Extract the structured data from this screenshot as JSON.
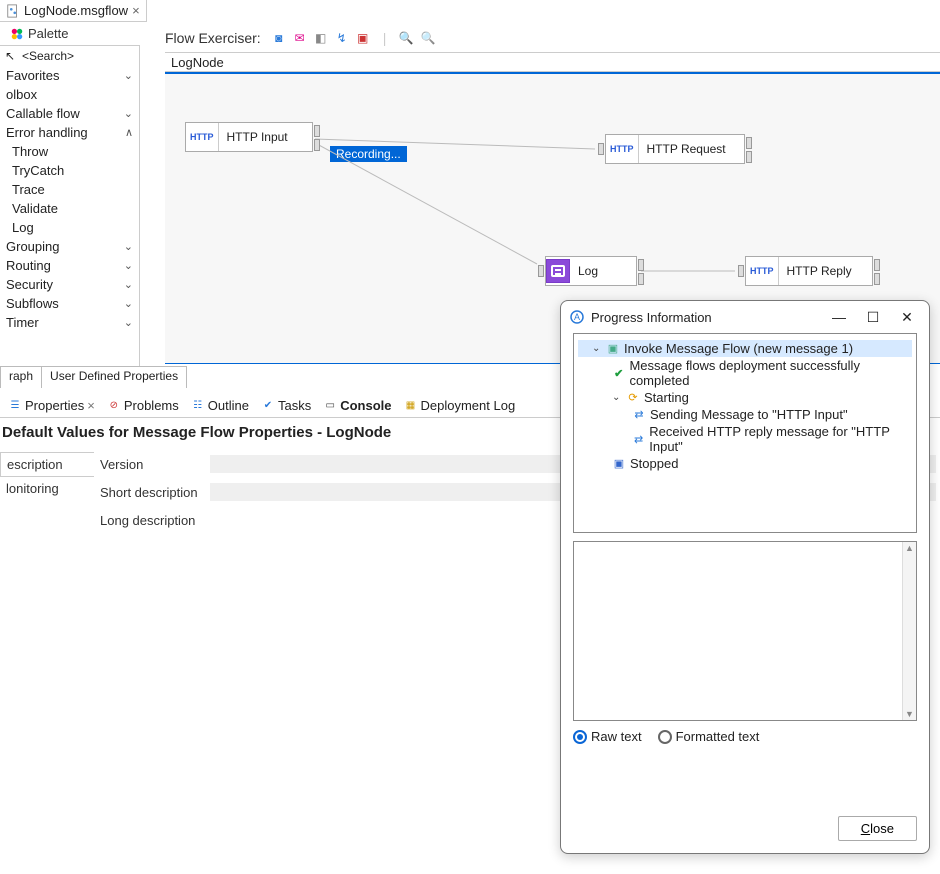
{
  "editorTab": {
    "title": "LogNode.msgflow",
    "close": "×"
  },
  "palette": {
    "title": "Palette"
  },
  "sidebar": {
    "search": "<Search>",
    "items": [
      {
        "label": "Favorites",
        "chev": "⌄"
      },
      {
        "label": "olbox"
      },
      {
        "label": "Callable flow",
        "chev": "⌄"
      },
      {
        "label": "Error handling",
        "chev": "∧"
      },
      {
        "label": "Throw",
        "child": true
      },
      {
        "label": "TryCatch",
        "child": true
      },
      {
        "label": "Trace",
        "child": true
      },
      {
        "label": "Validate",
        "child": true
      },
      {
        "label": "Log",
        "child": true
      },
      {
        "label": "Grouping",
        "chev": "⌄"
      },
      {
        "label": "Routing",
        "chev": "⌄"
      },
      {
        "label": "Security",
        "chev": "⌄"
      },
      {
        "label": "Subflows",
        "chev": "⌄"
      },
      {
        "label": "Timer",
        "chev": "⌄"
      }
    ]
  },
  "flowBar": {
    "label": "Flow Exerciser:"
  },
  "canvas": {
    "title": "LogNode",
    "recording": "Recording...",
    "nodes": {
      "httpInput": {
        "pill": "HTTP",
        "label": "HTTP Input"
      },
      "httpRequest": {
        "pill": "HTTP",
        "label": "HTTP Request"
      },
      "log": {
        "label": "Log"
      },
      "httpReply": {
        "pill": "HTTP",
        "label": "HTTP Reply"
      }
    }
  },
  "midTabs": {
    "graph": "raph",
    "udp": "User Defined Properties"
  },
  "views": {
    "properties": "Properties",
    "problems": "Problems",
    "outline": "Outline",
    "tasks": "Tasks",
    "console": "Console",
    "deployLog": "Deployment Log"
  },
  "properties": {
    "title": "Default Values for Message Flow Properties - LogNode",
    "leftTabs": {
      "description": "escription",
      "monitoring": "lonitoring"
    },
    "rows": {
      "version": "Version",
      "short": "Short description",
      "long": "Long description"
    }
  },
  "dialog": {
    "title": "Progress Information",
    "tree": {
      "root": "Invoke Message Flow (new message 1)",
      "deploy": "Message flows deployment successfully completed",
      "starting": "Starting",
      "send": "Sending Message to \"HTTP Input\"",
      "recv": "Received HTTP reply message for \"HTTP Input\"",
      "stopped": "Stopped"
    },
    "radio": {
      "raw": "Raw text",
      "formatted": "Formatted text"
    },
    "close": "lose",
    "closePrefix": "C"
  }
}
